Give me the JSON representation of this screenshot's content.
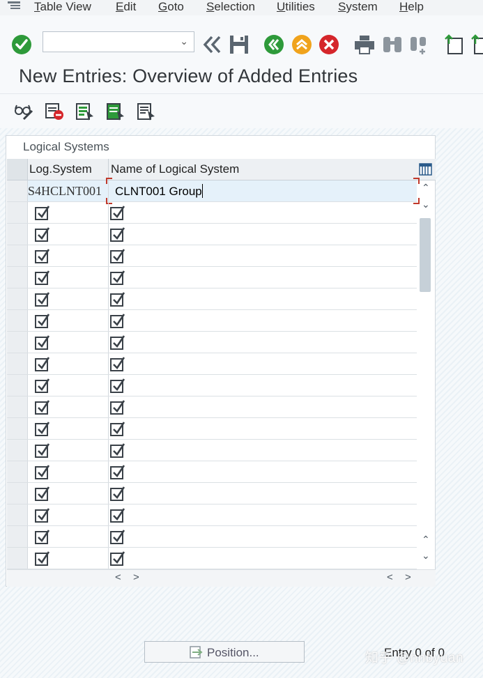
{
  "menu": {
    "items": [
      {
        "label": "Table View",
        "u": "T",
        "rest": "able View"
      },
      {
        "label": "Edit",
        "u": "E",
        "rest": "dit"
      },
      {
        "label": "Goto",
        "u": "G",
        "rest": "oto"
      },
      {
        "label": "Selection",
        "u": "S",
        "rest": "election"
      },
      {
        "label": "Utilities",
        "u": "U",
        "rest": "tilities"
      },
      {
        "label": "System",
        "u": "S",
        "rest": "ystem"
      },
      {
        "label": "Help",
        "u": "H",
        "rest": "elp"
      }
    ]
  },
  "toolbar": {
    "command_value": "",
    "dropdown_glyph": "⌄",
    "icons": [
      "enter-icon",
      "back-double-icon",
      "save-icon",
      "back-icon",
      "exit-icon",
      "cancel-icon",
      "print-icon",
      "find-icon",
      "find-next-icon",
      "first-page-icon",
      "prev-page-icon"
    ],
    "colors": {
      "green": "#2e9a3a",
      "orange": "#f0a31c",
      "red": "#d5262b",
      "gray": "#5b6670"
    }
  },
  "title": "New Entries: Overview of Added Entries",
  "app_toolbar": {
    "icons": [
      "display-change-icon",
      "delete-entry-icon",
      "select-all-icon",
      "select-block-icon",
      "deselect-all-icon"
    ]
  },
  "table": {
    "caption": "Logical Systems",
    "columns": [
      "Log.System",
      "Name of Logical System"
    ],
    "active_row": {
      "log_system": "S4HCLNT001",
      "name": "CLNT001 Group"
    },
    "empty_rows": 17,
    "checkbox_glyph": "☑"
  },
  "scroll": {
    "up": "⌃",
    "down": "⌄",
    "left": "<",
    "right": ">"
  },
  "footer": {
    "position_button": "Position...",
    "entry_info": "Entry 0 of 0",
    "watermark": "知乎 @hnbyuan"
  }
}
